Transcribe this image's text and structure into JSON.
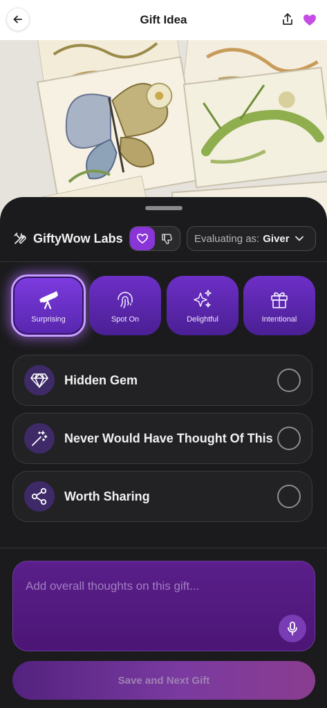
{
  "header": {
    "title": "Gift Idea",
    "back_icon": "arrow-left-icon",
    "share_icon": "share-icon",
    "favorite_icon": "heart-icon",
    "favorite_color": "#c64ce6"
  },
  "hero": {
    "description_icon": "gift-photo"
  },
  "labs": {
    "name": "GiftyWow Labs",
    "icon": "tools-icon",
    "like_icon": "heart-outline-icon",
    "dislike_icon": "thumbs-down-icon",
    "evaluating_label": "Evaluating as:",
    "evaluating_value": "Giver"
  },
  "categories": [
    {
      "label": "Surprising",
      "icon": "telescope-icon",
      "selected": true
    },
    {
      "label": "Spot On",
      "icon": "fingerprint-icon",
      "selected": false
    },
    {
      "label": "Delightful",
      "icon": "sparkles-icon",
      "selected": false
    },
    {
      "label": "Intentional",
      "icon": "gift-icon",
      "selected": false
    }
  ],
  "options": [
    {
      "label": "Hidden Gem",
      "icon": "diamond-icon",
      "checked": false
    },
    {
      "label": "Never Would Have Thought Of This",
      "icon": "magic-wand-icon",
      "checked": false
    },
    {
      "label": "Worth Sharing",
      "icon": "share-nodes-icon",
      "checked": false
    }
  ],
  "notes": {
    "placeholder": "Add overall thoughts on this gift...",
    "mic_icon": "microphone-icon"
  },
  "save_button": {
    "label": "Save and Next Gift"
  },
  "colors": {
    "accent": "#8a35d8",
    "sheet_bg": "#1b1b1d",
    "tile": "#6d2fc7"
  }
}
